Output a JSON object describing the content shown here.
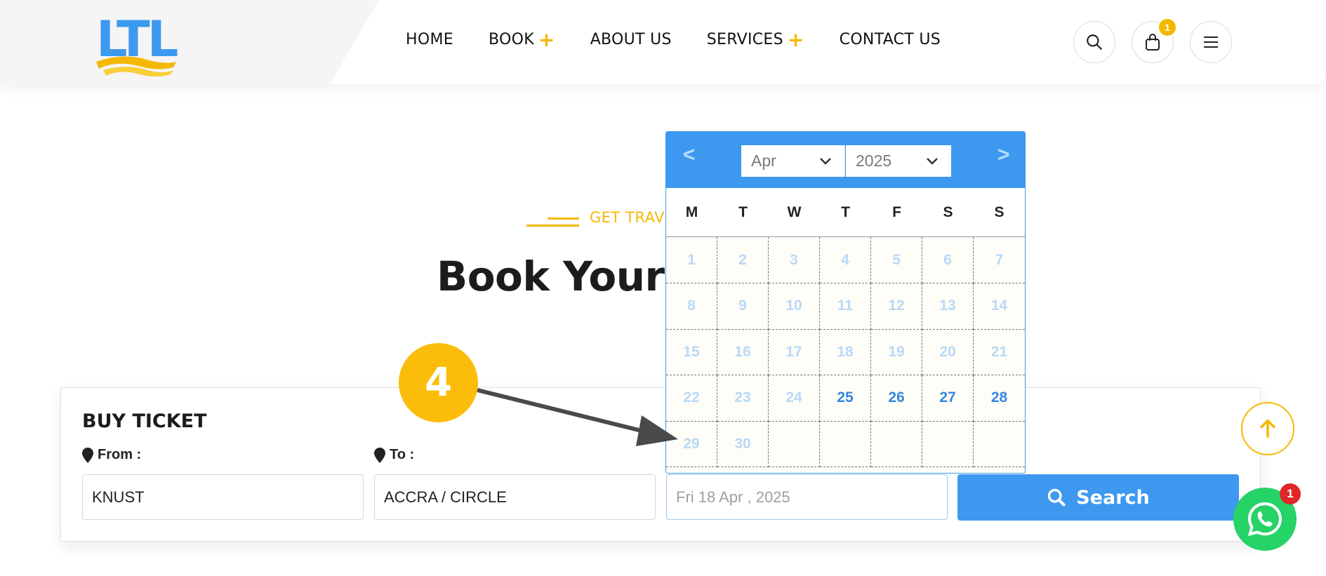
{
  "logo": {
    "text": "LTL"
  },
  "nav": {
    "items": [
      {
        "label": "HOME",
        "has_plus": false
      },
      {
        "label": "BOOK",
        "has_plus": true
      },
      {
        "label": "ABOUT US",
        "has_plus": false
      },
      {
        "label": "SERVICES",
        "has_plus": true
      },
      {
        "label": "CONTACT US",
        "has_plus": false
      }
    ],
    "plus_symbol": "+"
  },
  "header_actions": {
    "cart_count": "1",
    "icons": [
      "search-icon",
      "shopping-bag-icon",
      "menu-icon"
    ]
  },
  "hero": {
    "subtitle": "GET TRAVELLING",
    "title": "Book Your Trip Today"
  },
  "booking": {
    "title": "BUY TICKET",
    "from_label": "From :",
    "to_label": "To :",
    "from_value": "KNUST",
    "to_value": "ACCRA / CIRCLE",
    "date_placeholder": "Fri 18 Apr , 2025",
    "search_label": "Search"
  },
  "calendar": {
    "prev": "<",
    "next": ">",
    "month": "Apr",
    "year": "2025",
    "weekdays": [
      "M",
      "T",
      "W",
      "T",
      "F",
      "S",
      "S"
    ],
    "days": [
      "1",
      "2",
      "3",
      "4",
      "5",
      "6",
      "7",
      "8",
      "9",
      "10",
      "11",
      "12",
      "13",
      "14",
      "15",
      "16",
      "17",
      "18",
      "19",
      "20",
      "21",
      "22",
      "23",
      "24",
      "25",
      "26",
      "27",
      "28",
      "29",
      "30"
    ],
    "first_day_offset": 1,
    "available_days": [
      "25",
      "26",
      "27",
      "28"
    ]
  },
  "annotation": {
    "step": "4"
  },
  "whatsapp": {
    "badge": "1"
  },
  "colors": {
    "accent": "#f5b800",
    "primary": "#3d99f0",
    "whatsapp": "#25d366"
  }
}
